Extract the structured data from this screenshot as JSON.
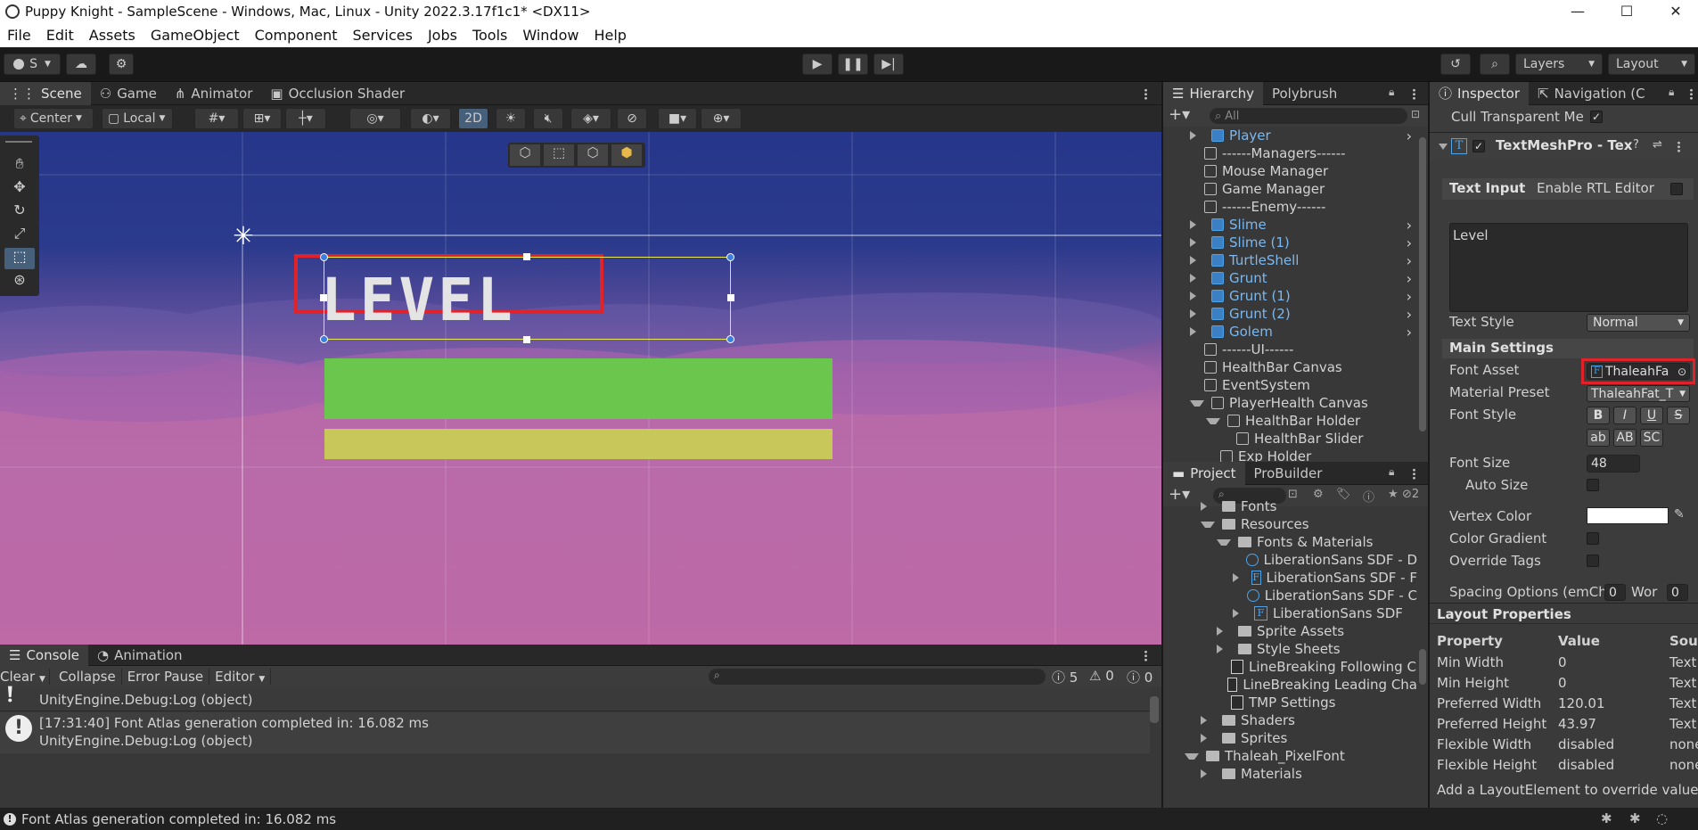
{
  "window": {
    "title": "Puppy Knight - SampleScene - Windows, Mac, Linux - Unity 2022.3.17f1c1* <DX11>",
    "min": "—",
    "max": "☐",
    "close": "✕"
  },
  "menu": [
    "File",
    "Edit",
    "Assets",
    "GameObject",
    "Component",
    "Services",
    "Jobs",
    "Tools",
    "Window",
    "Help"
  ],
  "toolbar": {
    "account": "S",
    "layers": "Layers",
    "layout": "Layout"
  },
  "scene_tabs": [
    "Scene",
    "Game",
    "Animator",
    "Occlusion Shader"
  ],
  "scene_toolbar": {
    "pivot": "Center",
    "space": "Local",
    "mode_2d": "2D"
  },
  "scene": {
    "level_text": "LEVEL",
    "colors": {
      "sky": "#26368a",
      "cloud": "#b86aa8",
      "green_bar": "#6ac64c",
      "yellow_bar": "#c8c85a",
      "highlight": "#e0222a"
    }
  },
  "console": {
    "tabs": [
      "Console",
      "Animation"
    ],
    "buttons": {
      "clear": "Clear",
      "collapse": "Collapse",
      "error_pause": "Error Pause",
      "editor": "Editor"
    },
    "counts": {
      "info": "5",
      "warn": "0",
      "error": "0"
    },
    "entries": [
      {
        "line1": "",
        "line2": "UnityEngine.Debug:Log (object)"
      },
      {
        "line1": "[17:31:40] Font Atlas generation completed in: 16.082 ms",
        "line2": "UnityEngine.Debug:Log (object)"
      }
    ]
  },
  "status_bar": "Font Atlas generation completed in: 16.082 ms",
  "hierarchy": {
    "tabs": [
      "Hierarchy",
      "Polybrush"
    ],
    "search_placeholder": "All",
    "items": [
      {
        "label": "Player",
        "prefab": true,
        "expand": "right"
      },
      {
        "label": "------Managers------",
        "prefab": false
      },
      {
        "label": "Mouse Manager",
        "prefab": false
      },
      {
        "label": "Game Manager",
        "prefab": false
      },
      {
        "label": "------Enemy------",
        "prefab": false
      },
      {
        "label": "Slime",
        "prefab": true,
        "expand": "right"
      },
      {
        "label": "Slime (1)",
        "prefab": true,
        "expand": "right"
      },
      {
        "label": "TurtleShell",
        "prefab": true,
        "expand": "right"
      },
      {
        "label": "Grunt",
        "prefab": true,
        "expand": "right"
      },
      {
        "label": "Grunt (1)",
        "prefab": true,
        "expand": "right"
      },
      {
        "label": "Grunt (2)",
        "prefab": true,
        "expand": "right"
      },
      {
        "label": "Golem",
        "prefab": true,
        "expand": "right"
      },
      {
        "label": "------UI------",
        "prefab": false
      },
      {
        "label": "HealthBar Canvas",
        "prefab": false
      },
      {
        "label": "EventSystem",
        "prefab": false
      },
      {
        "label": "PlayerHealth Canvas",
        "prefab": false,
        "expand": "down"
      },
      {
        "label": "HealthBar Holder",
        "prefab": false,
        "expand": "down",
        "indent": 1
      },
      {
        "label": "HealthBar Slider",
        "prefab": false,
        "indent": 2
      },
      {
        "label": "Exp Holder",
        "prefab": false,
        "indent": 1
      }
    ]
  },
  "project": {
    "tabs": [
      "Project",
      "ProBuilder"
    ],
    "hidden_count": "2",
    "items": [
      {
        "label": "Fonts",
        "type": "folder",
        "indent": 1,
        "expand": "right"
      },
      {
        "label": "Resources",
        "type": "folder",
        "indent": 1,
        "expand": "down"
      },
      {
        "label": "Fonts & Materials",
        "type": "folder",
        "indent": 2,
        "expand": "down"
      },
      {
        "label": "LiberationSans SDF - D",
        "type": "material",
        "indent": 3
      },
      {
        "label": "LiberationSans SDF - F",
        "type": "font",
        "indent": 3,
        "expand": "right"
      },
      {
        "label": "LiberationSans SDF - C",
        "type": "material",
        "indent": 3
      },
      {
        "label": "LiberationSans SDF",
        "type": "font",
        "indent": 3,
        "expand": "right"
      },
      {
        "label": "Sprite Assets",
        "type": "folder",
        "indent": 2,
        "expand": "right"
      },
      {
        "label": "Style Sheets",
        "type": "folder",
        "indent": 2,
        "expand": "right"
      },
      {
        "label": "LineBreaking Following C",
        "type": "file",
        "indent": 2
      },
      {
        "label": "LineBreaking Leading Cha",
        "type": "file",
        "indent": 2
      },
      {
        "label": "TMP Settings",
        "type": "file",
        "indent": 2
      },
      {
        "label": "Shaders",
        "type": "folder",
        "indent": 1,
        "expand": "right"
      },
      {
        "label": "Sprites",
        "type": "folder",
        "indent": 1,
        "expand": "right"
      },
      {
        "label": "Thaleah_PixelFont",
        "type": "folder",
        "indent": 0,
        "expand": "down"
      },
      {
        "label": "Materials",
        "type": "folder",
        "indent": 1,
        "expand": "right"
      }
    ]
  },
  "inspector": {
    "tabs": [
      "Inspector",
      "Navigation (C"
    ],
    "cull_label": "Cull Transparent Me",
    "component_title": "TextMeshPro - Tex",
    "text_input_label": "Text Input",
    "rtl_label": "Enable RTL Editor",
    "text_value": "Level",
    "text_style_label": "Text Style",
    "text_style_value": "Normal",
    "main_settings": "Main Settings",
    "font_asset_label": "Font Asset",
    "font_asset_value": "ThaleahFa",
    "material_preset_label": "Material Preset",
    "material_preset_value": "ThaleahFat_T",
    "font_style_label": "Font Style",
    "style_buttons": [
      "B",
      "I",
      "U",
      "S",
      "ab",
      "AB",
      "SC"
    ],
    "font_size_label": "Font Size",
    "font_size_value": "48",
    "auto_size_label": "Auto Size",
    "vertex_color_label": "Vertex Color",
    "color_gradient_label": "Color Gradient",
    "override_tags_label": "Override Tags",
    "spacing_label": "Spacing Options (emCha",
    "spacing_char": "0",
    "spacing_word_label": "Wor",
    "spacing_word": "0",
    "layout_title": "Layout Properties",
    "layout_headers": [
      "Property",
      "Value",
      "Sou"
    ],
    "layout_rows": [
      [
        "Min Width",
        "0",
        "Text"
      ],
      [
        "Min Height",
        "0",
        "Text"
      ],
      [
        "Preferred Width",
        "120.01",
        "Text"
      ],
      [
        "Preferred Height",
        "43.97",
        "Text"
      ],
      [
        "Flexible Width",
        "disabled",
        "none"
      ],
      [
        "Flexible Height",
        "disabled",
        "none"
      ]
    ],
    "layout_footer": "Add a LayoutElement to override values."
  }
}
